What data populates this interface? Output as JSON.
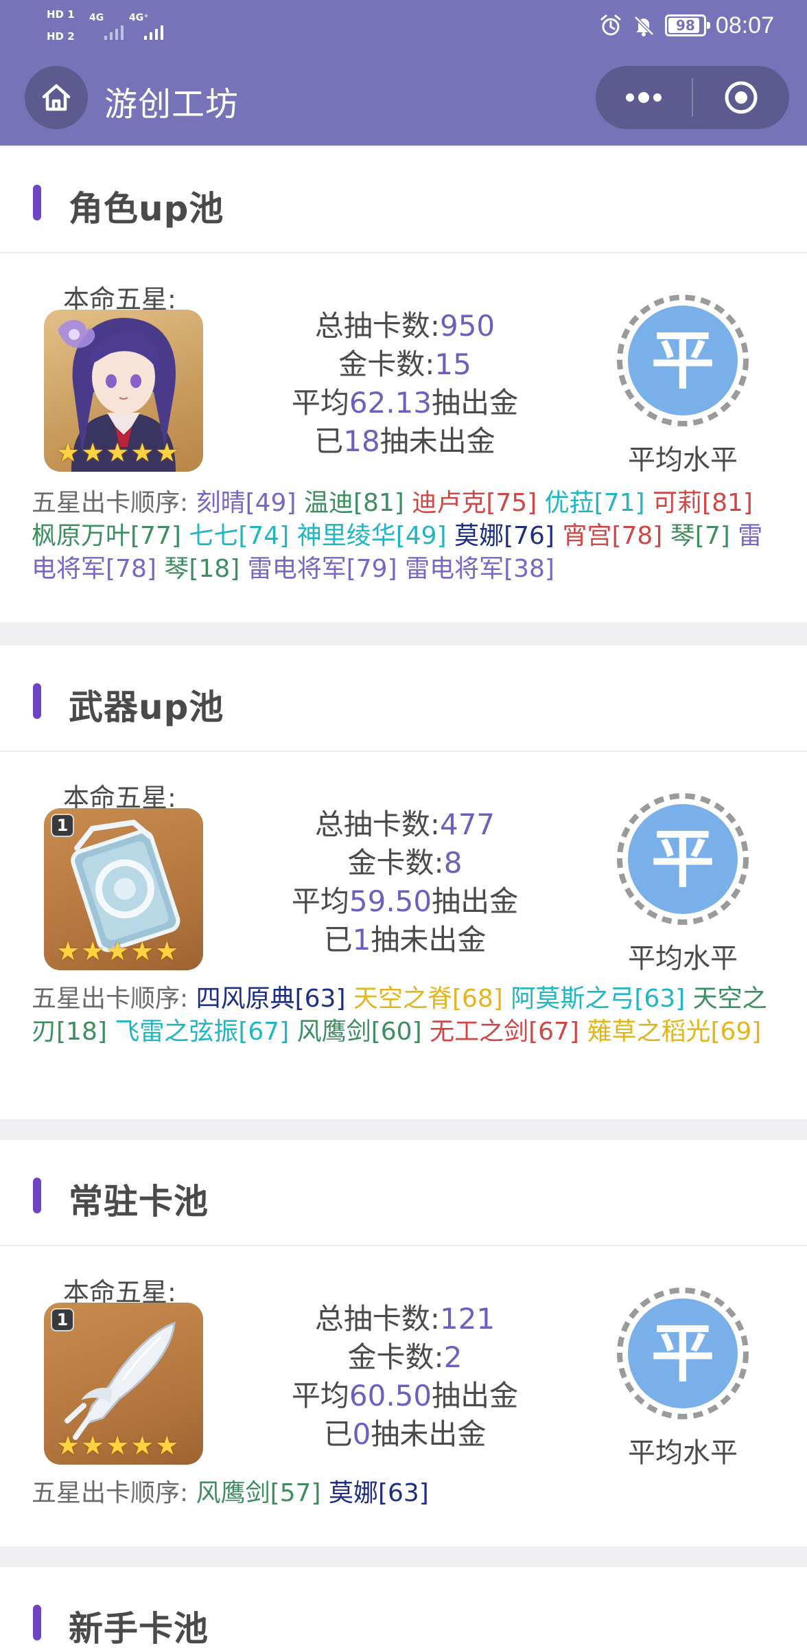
{
  "status_bar": {
    "sim1": "HD 1",
    "sim2": "HD 2",
    "net1": "4G",
    "net2": "4G⁺",
    "battery": "98",
    "time": "08:07",
    "icons": [
      "alarm-icon",
      "mute-icon",
      "battery-icon"
    ]
  },
  "titlebar": {
    "title": "游创工坊",
    "icons": [
      "home-icon",
      "more-icon",
      "close-icon"
    ]
  },
  "colors": {
    "header_bg": "#7773b9",
    "accent_bar": "#6f43c6",
    "number": "#6d5fbf",
    "medal": "#7ab0ea",
    "star": "#ffd23f"
  },
  "common": {
    "fate_label": "本命五星:",
    "order_lead": "五星出卡顺序:",
    "level_label": "平均水平",
    "medal_glyph": "平",
    "stars": "★★★★★"
  },
  "pools": [
    {
      "title": "角色up池",
      "portrait_kind": "character",
      "portrait_icon": "character-portrait-icon",
      "total_label": "总抽卡数:",
      "total": "950",
      "gold_label": "金卡数:",
      "gold": "15",
      "avg_prefix": "平均",
      "avg": "62.13",
      "avg_suffix": "抽出金",
      "pending_prefix": "已",
      "pending": "18",
      "pending_suffix": "抽未出金",
      "order": [
        {
          "name": "刻晴[49]",
          "color": "c-purple"
        },
        {
          "name": "温迪[81]",
          "color": "c-green"
        },
        {
          "name": "迪卢克[75]",
          "color": "c-red"
        },
        {
          "name": "优菈[71]",
          "color": "c-cyan"
        },
        {
          "name": "可莉[81]",
          "color": "c-red"
        },
        {
          "name": "枫原万叶[77]",
          "color": "c-green"
        },
        {
          "name": "七七[74]",
          "color": "c-cyan"
        },
        {
          "name": "神里绫华[49]",
          "color": "c-cyan"
        },
        {
          "name": "莫娜[76]",
          "color": "c-navy"
        },
        {
          "name": "宵宫[78]",
          "color": "c-red"
        },
        {
          "name": "琴[7]",
          "color": "c-green"
        },
        {
          "name": "雷电将军[78]",
          "color": "c-purple"
        },
        {
          "name": "琴[18]",
          "color": "c-green"
        },
        {
          "name": "雷电将军[79]",
          "color": "c-purple"
        },
        {
          "name": "雷电将军[38]",
          "color": "c-purple"
        }
      ]
    },
    {
      "title": "武器up池",
      "portrait_kind": "catalyst",
      "portrait_icon": "catalyst-weapon-icon",
      "badge": "1",
      "total_label": "总抽卡数:",
      "total": "477",
      "gold_label": "金卡数:",
      "gold": "8",
      "avg_prefix": "平均",
      "avg": "59.50",
      "avg_suffix": "抽出金",
      "pending_prefix": "已",
      "pending": "1",
      "pending_suffix": "抽未出金",
      "order": [
        {
          "name": "四风原典[63]",
          "color": "c-navy"
        },
        {
          "name": "天空之脊[68]",
          "color": "c-gold"
        },
        {
          "name": "阿莫斯之弓[63]",
          "color": "c-cyan"
        },
        {
          "name": "天空之刃[18]",
          "color": "c-green"
        },
        {
          "name": "飞雷之弦振[67]",
          "color": "c-cyan"
        },
        {
          "name": "风鹰剑[60]",
          "color": "c-green"
        },
        {
          "name": "无工之剑[67]",
          "color": "c-red"
        },
        {
          "name": "薙草之稻光[69]",
          "color": "c-gold"
        }
      ]
    },
    {
      "title": "常驻卡池",
      "portrait_kind": "sword",
      "portrait_icon": "sword-weapon-icon",
      "badge": "1",
      "total_label": "总抽卡数:",
      "total": "121",
      "gold_label": "金卡数:",
      "gold": "2",
      "avg_prefix": "平均",
      "avg": "60.50",
      "avg_suffix": "抽出金",
      "pending_prefix": "已",
      "pending": "0",
      "pending_suffix": "抽未出金",
      "order": [
        {
          "name": "风鹰剑[57]",
          "color": "c-green"
        },
        {
          "name": "莫娜[63]",
          "color": "c-navy"
        }
      ]
    },
    {
      "title": "新手卡池"
    }
  ]
}
